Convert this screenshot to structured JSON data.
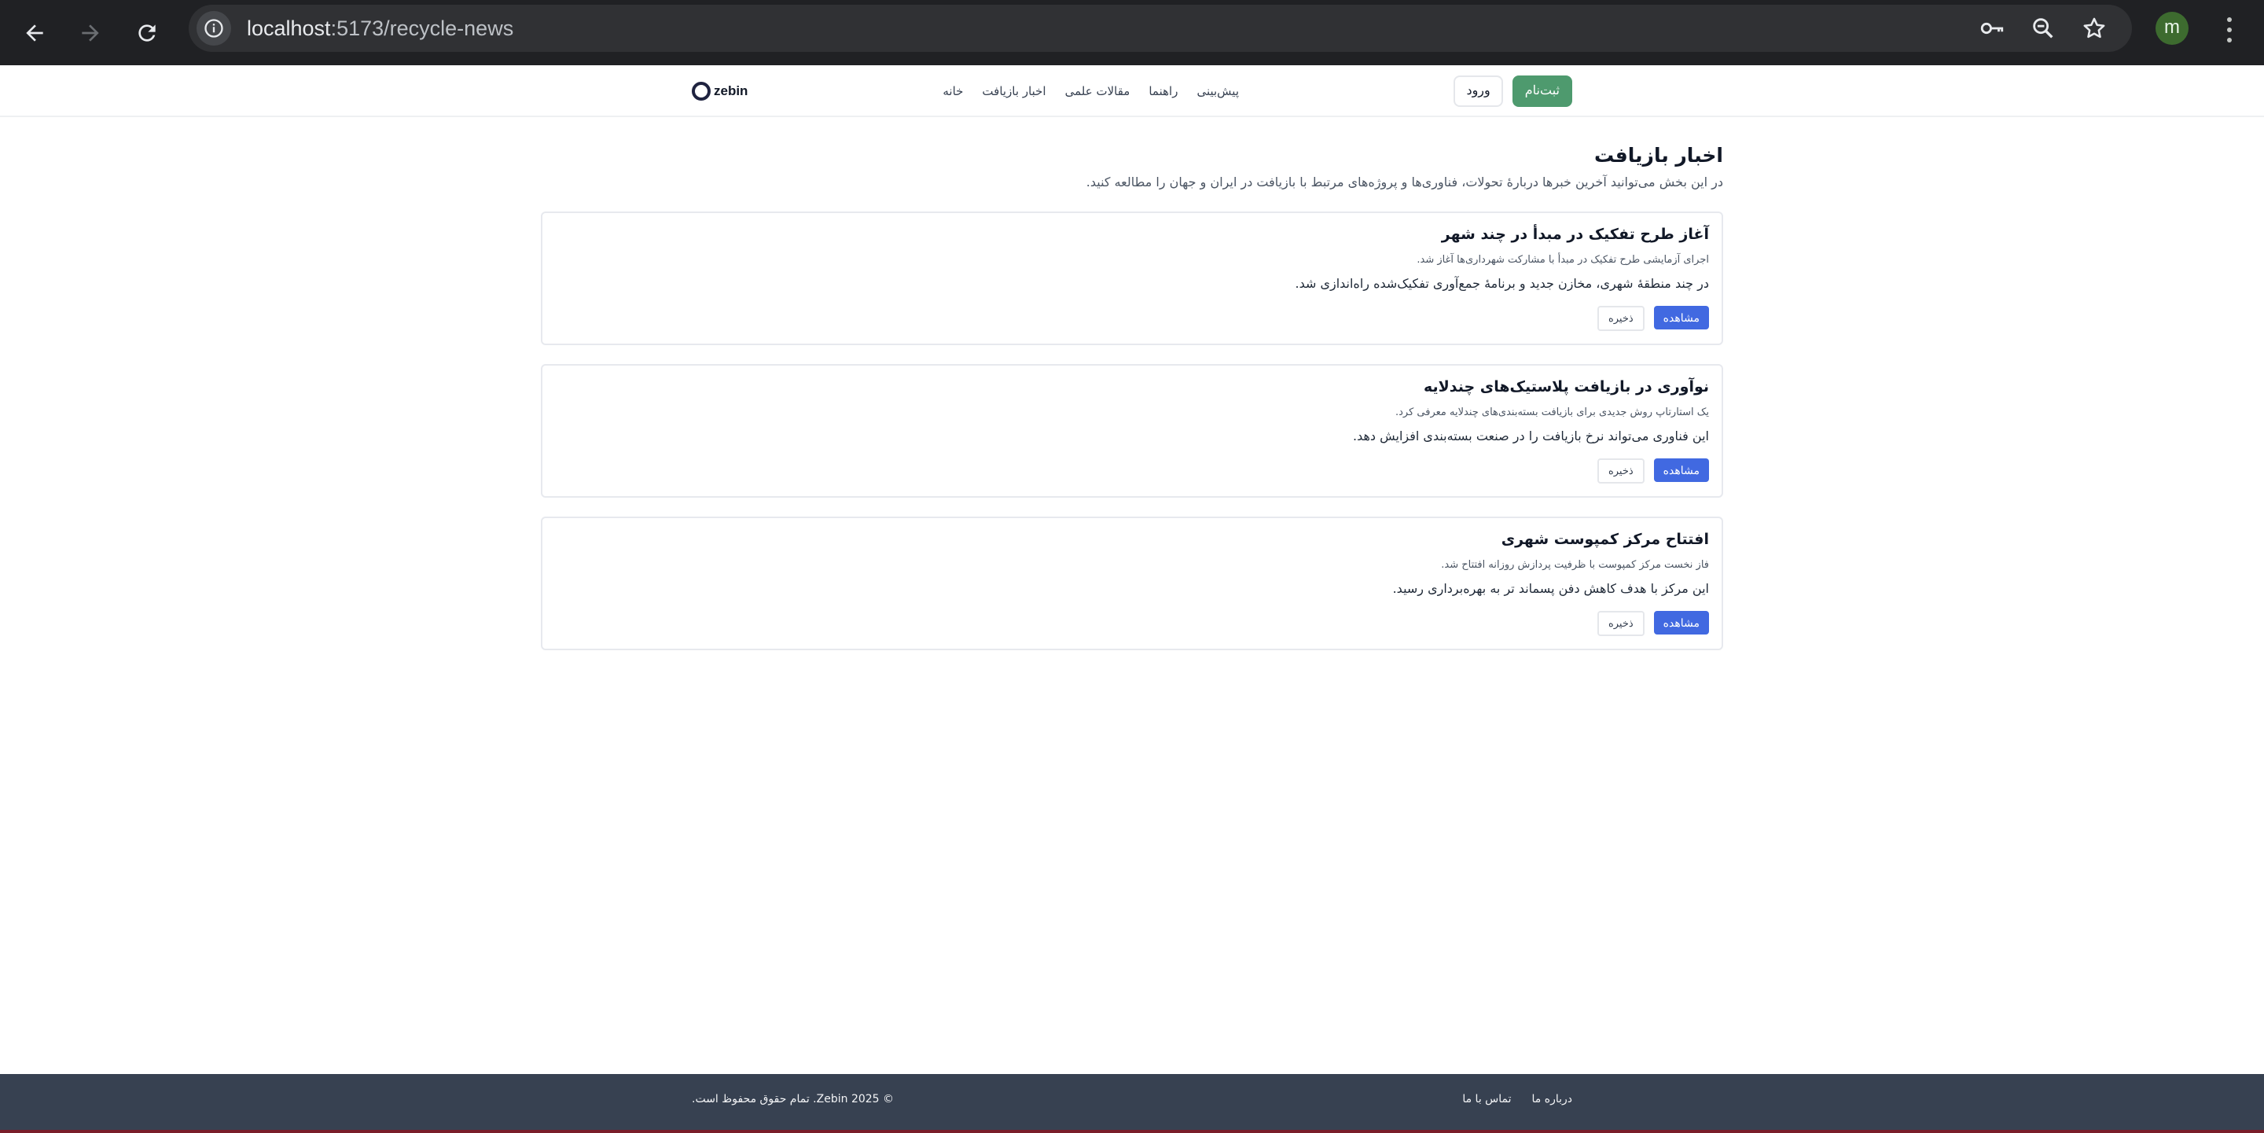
{
  "browser": {
    "url_host": "localhost",
    "url_path": ":5173/recycle-news",
    "profile_initial": "m"
  },
  "header": {
    "logo_text": "zebin",
    "nav": [
      {
        "label": "خانه"
      },
      {
        "label": "اخبار بازیافت"
      },
      {
        "label": "مقالات علمی"
      },
      {
        "label": "راهنما"
      },
      {
        "label": "پیش‌بینی"
      }
    ],
    "signup_label": "ثبت‌نام",
    "login_label": "ورود"
  },
  "main": {
    "title": "اخبار بازیافت",
    "description": "در این بخش می‌توانید آخرین خبرها دربارهٔ تحولات، فناوری‌ها و پروژه‌های مرتبط با بازیافت در ایران و جهان را مطالعه کنید.",
    "articles": [
      {
        "title": "آغاز طرح تفکیک در مبدأ در چند شهر",
        "subtitle": "اجرای آزمایشی طرح تفکیک در مبدأ با مشارکت شهرداری‌ها آغاز شد.",
        "body": "در چند منطقهٔ شهری، مخازن جدید و برنامهٔ جمع‌آوری تفکیک‌شده راه‌اندازی شد.",
        "view_label": "مشاهده",
        "save_label": "ذخیره"
      },
      {
        "title": "نوآوری در بازیافت پلاستیک‌های چندلایه",
        "subtitle": "یک استارتاپ روش جدیدی برای بازیافت بسته‌بندی‌های چندلایه معرفی کرد.",
        "body": "این فناوری می‌تواند نرخ بازیافت را در صنعت بسته‌بندی افزایش دهد.",
        "view_label": "مشاهده",
        "save_label": "ذخیره"
      },
      {
        "title": "افتتاح مرکز کمپوست شهری",
        "subtitle": "فاز نخست مرکز کمپوست با ظرفیت پردازش روزانه افتتاح شد.",
        "body": "این مرکز با هدف کاهش دفن پسماند تر به بهره‌برداری رسید.",
        "view_label": "مشاهده",
        "save_label": "ذخیره"
      }
    ]
  },
  "footer": {
    "links": [
      {
        "label": "درباره ما"
      },
      {
        "label": "تماس با ما"
      }
    ],
    "copyright": "© 2025 Zebin. تمام حقوق محفوظ است."
  }
}
